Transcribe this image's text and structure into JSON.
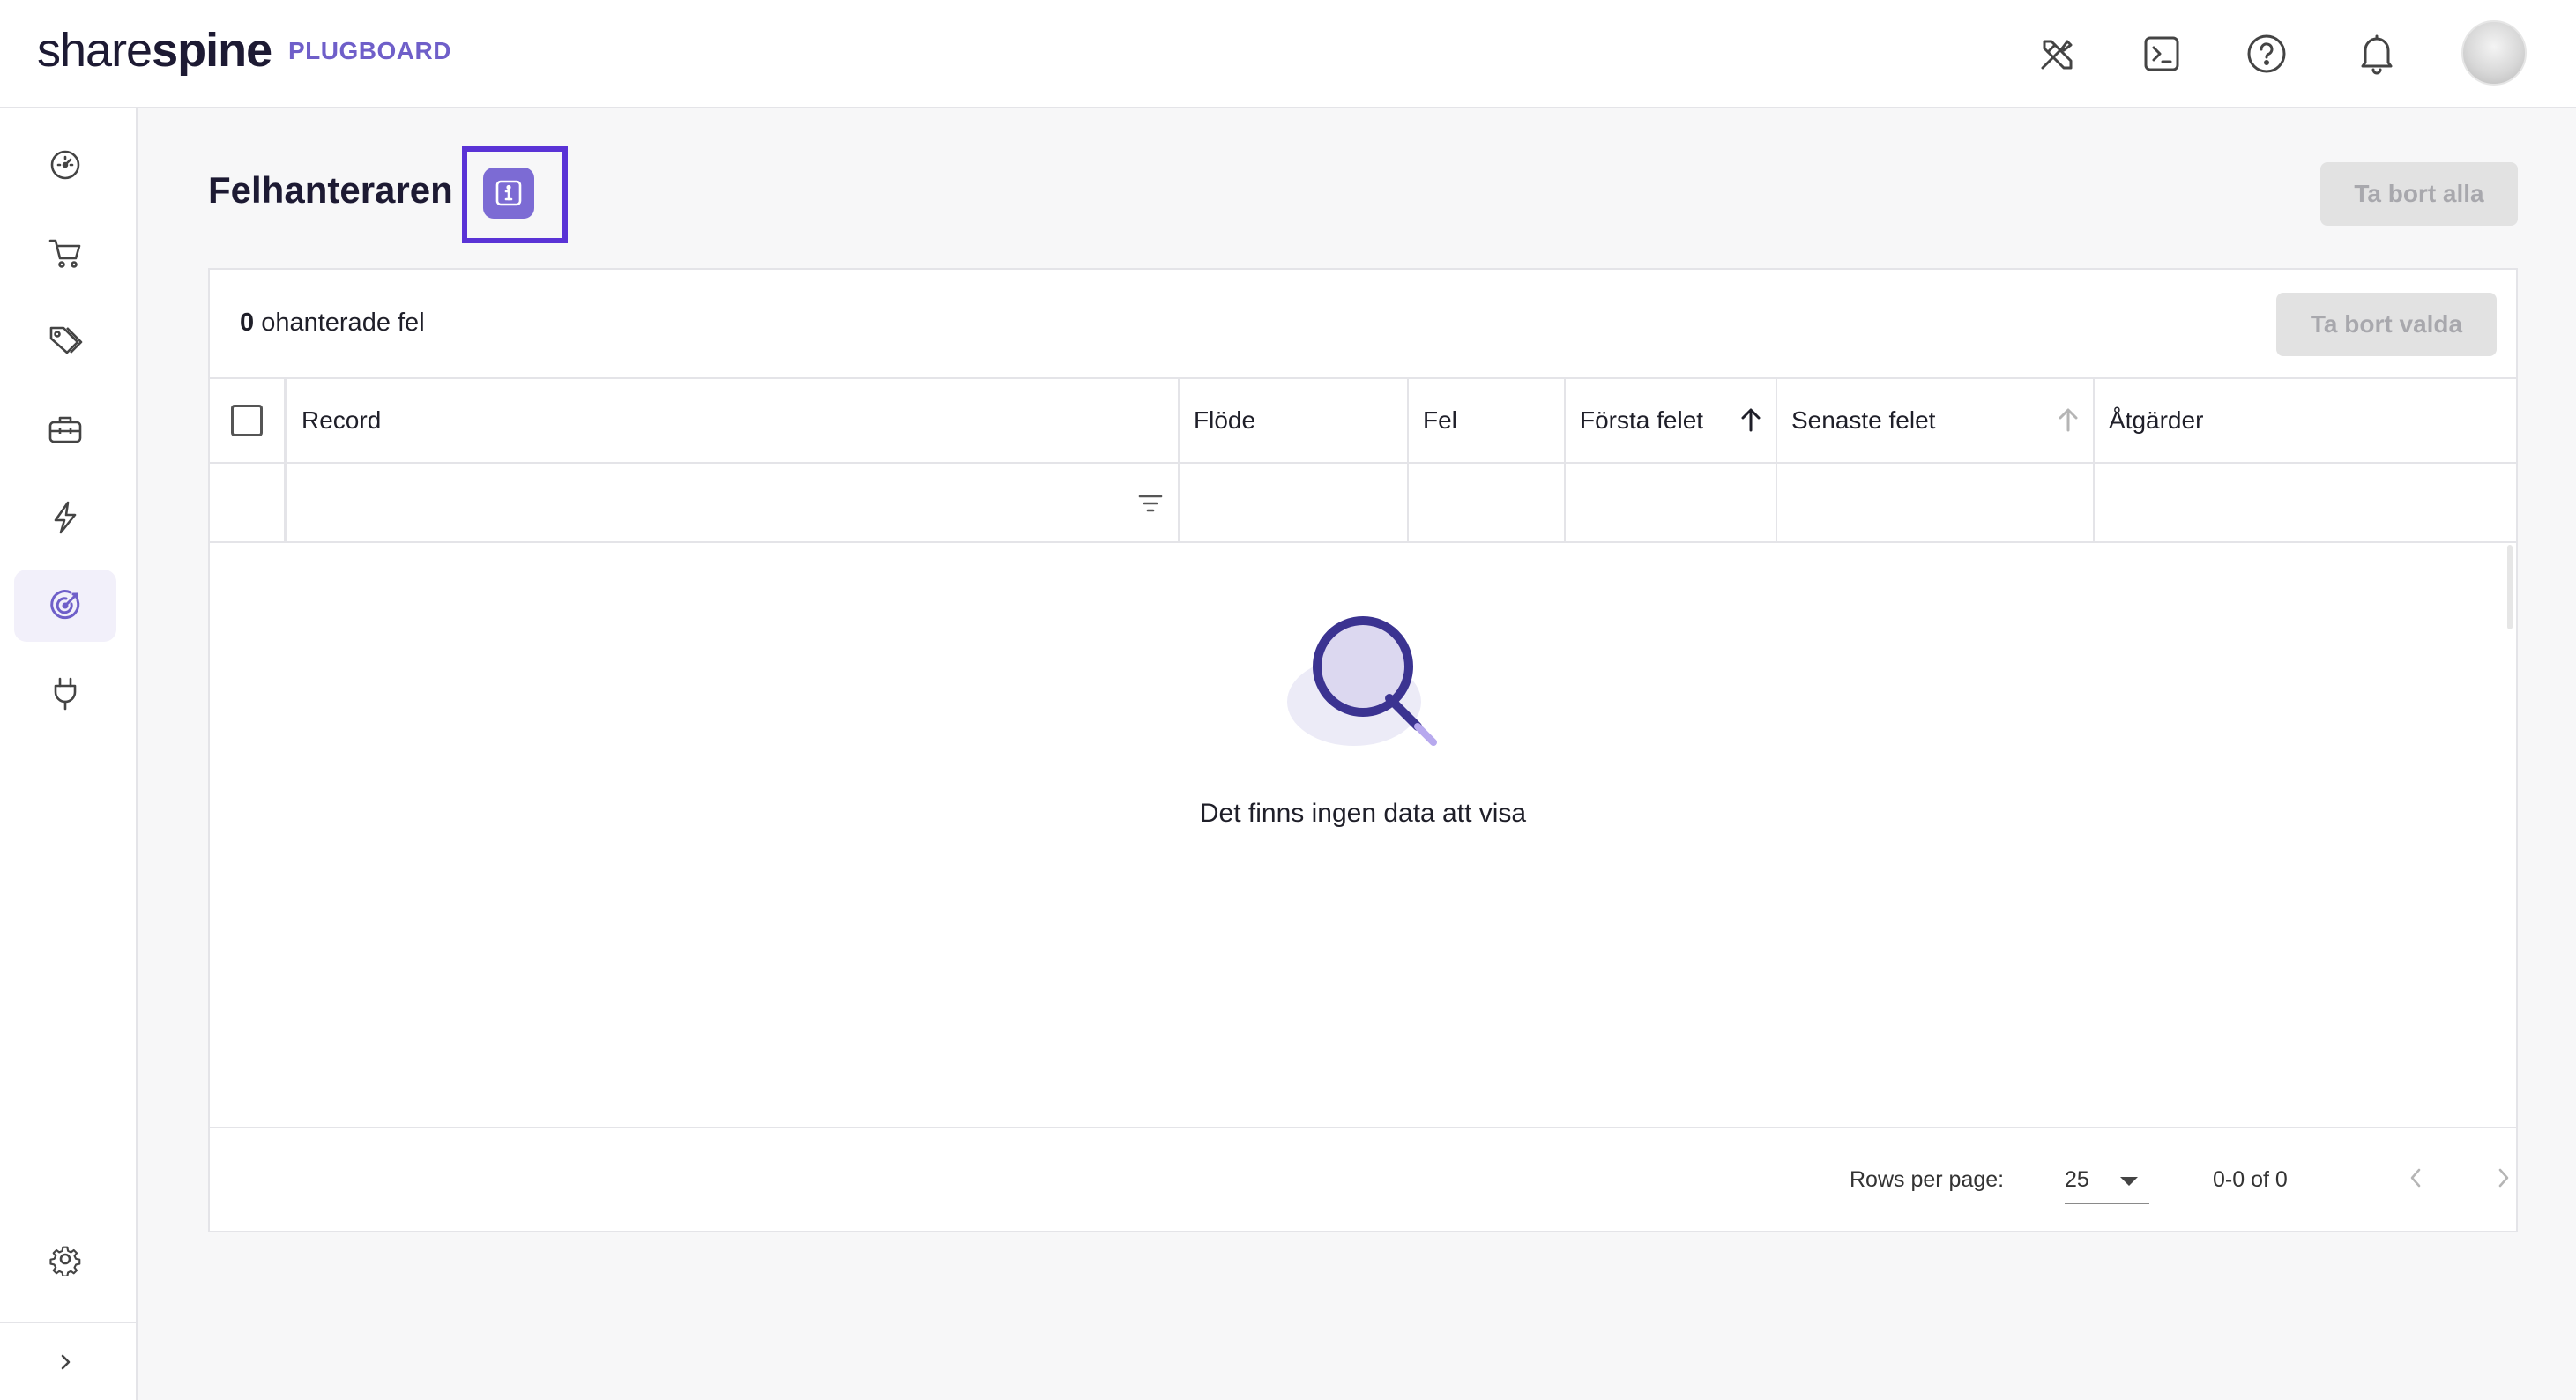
{
  "header": {
    "logo_light": "share",
    "logo_bold": "spine",
    "product": "PLUGBOARD",
    "icons": [
      "design-tools-icon",
      "terminal-icon",
      "help-icon",
      "bell-icon",
      "avatar"
    ]
  },
  "sidebar": {
    "items": [
      {
        "icon": "dashboard-icon"
      },
      {
        "icon": "cart-icon"
      },
      {
        "icon": "tags-icon"
      },
      {
        "icon": "toolbox-icon"
      },
      {
        "icon": "lightning-icon"
      },
      {
        "icon": "target-icon",
        "active": true
      },
      {
        "icon": "plug-icon"
      }
    ],
    "settings_icon": "gear-icon",
    "expand_icon": "chevron-right-icon"
  },
  "page": {
    "title": "Felhanteraren",
    "delete_all": "Ta bort alla"
  },
  "errors": {
    "count": "0",
    "count_label": "ohanterade fel",
    "delete_selected": "Ta bort valda",
    "columns": [
      "Record",
      "Flöde",
      "Fel",
      "Första felet",
      "Senaste felet",
      "Åtgärder"
    ],
    "empty_text": "Det finns ingen data att visa"
  },
  "pagination": {
    "rows_per_page_label": "Rows per page:",
    "rows_per_page": "25",
    "range": "0-0 of 0"
  },
  "colors": {
    "accent": "#6f5fc9",
    "highlight": "#5a33d6",
    "info_button": "#7c6bd4",
    "active_nav": "#f2f0fa"
  }
}
